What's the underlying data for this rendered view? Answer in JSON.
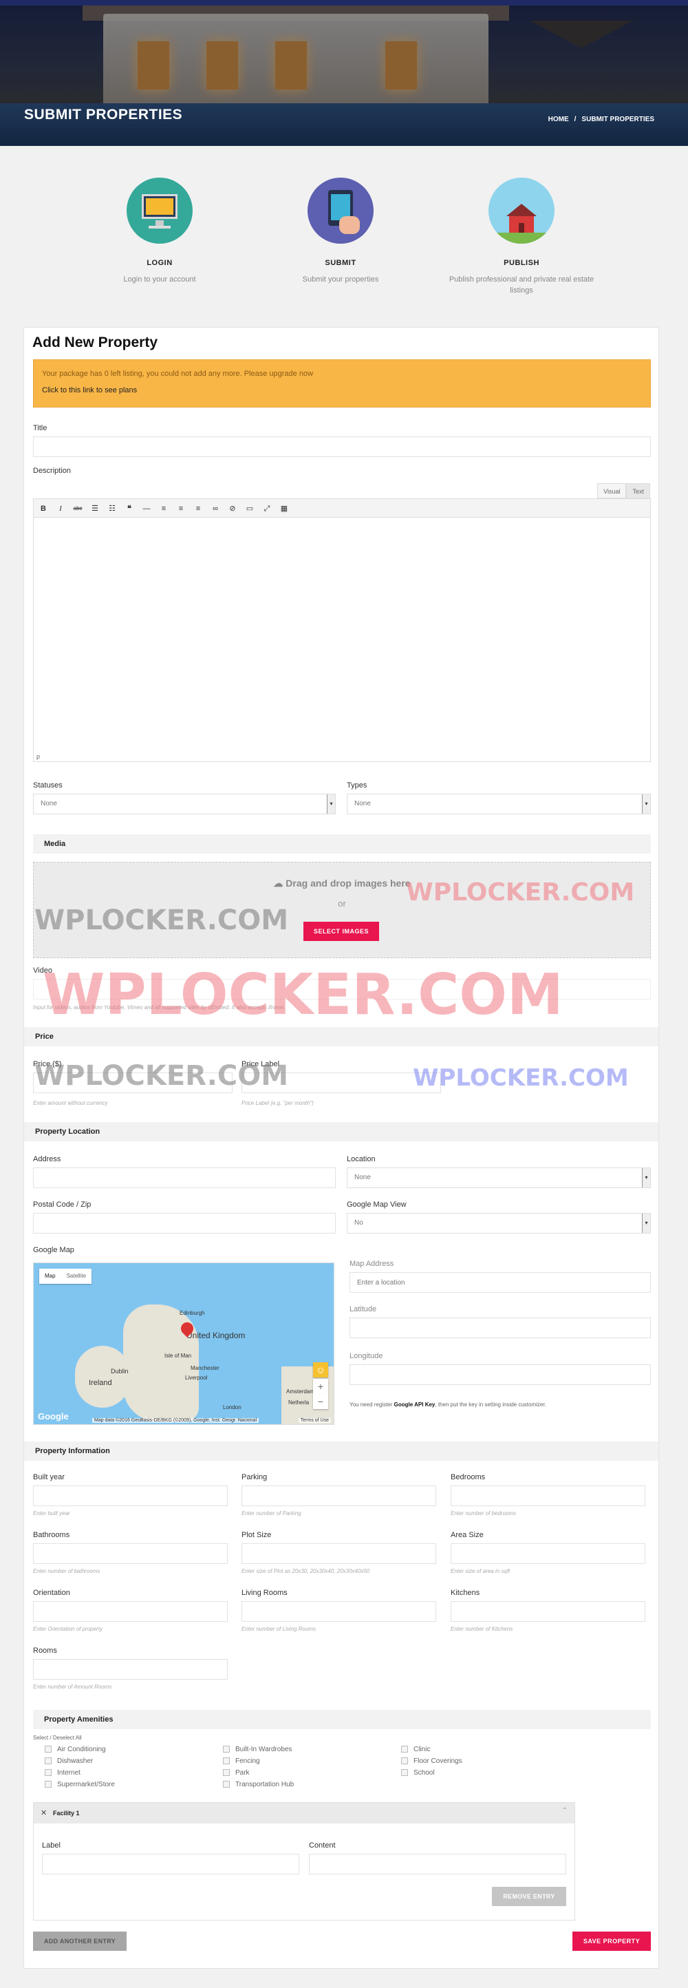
{
  "header": {
    "title": "SUBMIT PROPERTIES",
    "breadcrumb_home": "HOME",
    "breadcrumb_sep": "/",
    "breadcrumb_current": "SUBMIT PROPERTIES"
  },
  "steps": [
    {
      "title": "LOGIN",
      "desc": "Login to your account"
    },
    {
      "title": "SUBMIT",
      "desc": "Submit your properties"
    },
    {
      "title": "PUBLISH",
      "desc": "Publish professional and private real estate listings"
    }
  ],
  "form": {
    "heading": "Add New Property",
    "alert_line1": "Your package has 0 left listing, you could not add any more. Please upgrade now",
    "alert_line2": "Click to this link to see plans",
    "title_label": "Title",
    "description_label": "Description",
    "editor_tab_visual": "Visual",
    "editor_tab_text": "Text",
    "editor_path": "p",
    "statuses_label": "Statuses",
    "statuses_value": "None",
    "types_label": "Types",
    "types_value": "None",
    "media_title": "Media",
    "drop_text": "Drag and drop images here",
    "drop_or": "or",
    "select_images": "SELECT IMAGES",
    "video_label": "Video",
    "video_hint": "Input for videos, audios from Youtube, Vimeo and all supported sites by oEmbed. It also accepts iframe.",
    "price_title": "Price",
    "price_label": "Price ($)",
    "price_hint": "Enter amount without currency",
    "price_label2": "Price Label",
    "price_label_hint": "Price Label (e.g. \"per month\")",
    "location_title": "Property Location",
    "address_label": "Address",
    "location_label": "Location",
    "location_value": "None",
    "postal_label": "Postal Code / Zip",
    "mapview_label": "Google Map View",
    "mapview_value": "No",
    "gmap_label": "Google Map",
    "map_tab_map": "Map",
    "map_tab_sat": "Satellite",
    "map_address_label": "Map Address",
    "map_address_placeholder": "Enter a location",
    "latitude_label": "Latitude",
    "longitude_label": "Longitude",
    "api_note_pre": "You need register",
    "api_note_link": "Google API Key",
    "api_note_post": ", then put the key in setting inside customizer.",
    "map_labels": [
      "Edinburgh",
      "United Kingdom",
      "Isle of Man",
      "Dublin",
      "Ireland",
      "Manchester",
      "Liverpool",
      "London",
      "Amsterdam",
      "Netherla"
    ],
    "map_attr": "Map data ©2016 GeoBasis-DE/BKG (©2009), Google, Inst. Geogr. Nacional",
    "map_terms": "Terms of Use",
    "map_google": "Google",
    "info_title": "Property Information",
    "fields": [
      {
        "label": "Built year",
        "hint": "Enter built year"
      },
      {
        "label": "Parking",
        "hint": "Enter number of Parking"
      },
      {
        "label": "Bedrooms",
        "hint": "Enter number of bedrooms"
      },
      {
        "label": "Bathrooms",
        "hint": "Enter number of bathrooms"
      },
      {
        "label": "Plot Size",
        "hint": "Enter size of Plot as 20x30, 20x30x40, 20x30x40x50"
      },
      {
        "label": "Area Size",
        "hint": "Enter size of area in sqft"
      },
      {
        "label": "Orientation",
        "hint": "Enter Orientation of property"
      },
      {
        "label": "Living Rooms",
        "hint": "Enter number of Living Rooms"
      },
      {
        "label": "Kitchens",
        "hint": "Enter number of Kitchens"
      },
      {
        "label": "Rooms",
        "hint": "Enter number of Amount Rooms"
      }
    ],
    "amenities_title": "Property Amenities",
    "amenities_select": "Select / Deselect All",
    "amenities": [
      "Air Conditioning",
      "Dishwasher",
      "Internet",
      "Supermarket/Store",
      "Built-In Wardrobes",
      "Fencing",
      "Park",
      "Transportation Hub",
      "Clinic",
      "Floor Coverings",
      "School"
    ],
    "facility_name": "Facility 1",
    "facility_label": "Label",
    "facility_content": "Content",
    "remove_entry": "REMOVE ENTRY",
    "add_entry": "ADD ANOTHER ENTRY",
    "save_property": "SAVE PROPERTY"
  },
  "watermark": "WPLOCKER.COM",
  "colors": {
    "accent": "#e8154f",
    "alert": "#f8b647",
    "grey_button": "#a7a7a7"
  }
}
